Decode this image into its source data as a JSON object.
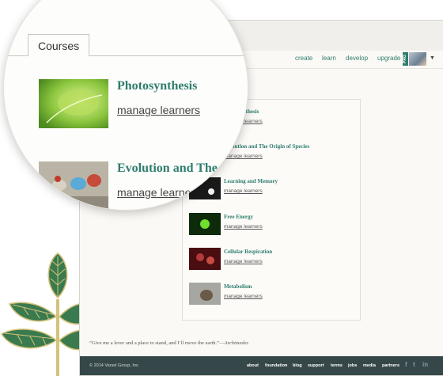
{
  "nav": {
    "links": [
      "create",
      "learn",
      "develop",
      "upgrade"
    ],
    "pro_badge": "PRO"
  },
  "courses": {
    "tab_label": "Courses",
    "items": [
      {
        "title": "Photosynthesis",
        "manage": "manage learners",
        "thumb": "green-leaves"
      },
      {
        "title": "Evolution and The Origin of Species",
        "manage": "manage learners",
        "thumb": "birds"
      },
      {
        "title": "Learning and Memory",
        "manage": "manage learners",
        "thumb": "dark-neurons"
      },
      {
        "title": "Free Energy",
        "manage": "manage learners",
        "thumb": "green-glow"
      },
      {
        "title": "Cellular Respiration",
        "manage": "manage learners",
        "thumb": "red-cells"
      },
      {
        "title": "Metabolism",
        "manage": "manage learners",
        "thumb": "animal-photo"
      }
    ],
    "magnified": [
      {
        "title": "Photosynthesis",
        "manage": "manage learners"
      },
      {
        "title": "Evolution and The O",
        "manage": "manage learners"
      }
    ]
  },
  "quote": {
    "text": "“Give me a lever and a place to stand, and I’ll move the earth.”—",
    "author": "Archimedes"
  },
  "footer": {
    "copyright": "© 2014 Varsel Group, Inc.",
    "links": [
      "about",
      "foundation",
      "blog",
      "support",
      "terms",
      "jobs",
      "media",
      "partners"
    ],
    "social": [
      "f",
      "t",
      "in"
    ]
  },
  "colors": {
    "accent": "#2e7d6e",
    "footer_bg": "#36474a"
  }
}
